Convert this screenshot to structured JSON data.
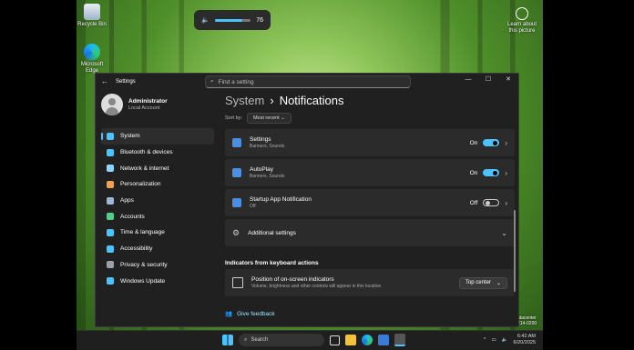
{
  "desktop": {
    "recycle_bin": "Recycle Bin",
    "edge_label": "Microsoft Edge",
    "learn_label": "Learn about this picture",
    "watermark_line1": "atacenter",
    "watermark_line2": "214-0200"
  },
  "volume": {
    "level": 76,
    "label": "76"
  },
  "window": {
    "title": "Settings",
    "search_placeholder": "Find a setting",
    "controls": {
      "minimize": "—",
      "maximize": "☐",
      "close": "✕"
    }
  },
  "profile": {
    "name": "Administrator",
    "subtitle": "Local Account"
  },
  "sidebar": {
    "items": [
      {
        "label": "System",
        "icon": "monitor-icon",
        "color": "#4cc2ff",
        "active": true
      },
      {
        "label": "Bluetooth & devices",
        "icon": "bluetooth-icon",
        "color": "#4cc2ff"
      },
      {
        "label": "Network & internet",
        "icon": "wifi-icon",
        "color": "#8fd3ff"
      },
      {
        "label": "Personalization",
        "icon": "brush-icon",
        "color": "#f0a050"
      },
      {
        "label": "Apps",
        "icon": "apps-icon",
        "color": "#9fb7d6"
      },
      {
        "label": "Accounts",
        "icon": "person-icon",
        "color": "#4fd08a"
      },
      {
        "label": "Time & language",
        "icon": "globe-icon",
        "color": "#4cc2ff"
      },
      {
        "label": "Accessibility",
        "icon": "accessibility-icon",
        "color": "#4cc2ff"
      },
      {
        "label": "Privacy & security",
        "icon": "shield-icon",
        "color": "#9aa0a6"
      },
      {
        "label": "Windows Update",
        "icon": "update-icon",
        "color": "#4cc2ff"
      }
    ]
  },
  "main": {
    "breadcrumb_parent": "System",
    "breadcrumb_sep": "›",
    "page_title": "Notifications",
    "sort_label": "Sort by:",
    "sort_value": "Most recent",
    "apps": [
      {
        "title": "Settings",
        "subtitle": "Banners, Sounds",
        "state": "On",
        "on": true,
        "icon_color": "#4a90e2"
      },
      {
        "title": "AutoPlay",
        "subtitle": "Banners, Sounds",
        "state": "On",
        "on": true,
        "icon_color": "#4a90e2"
      },
      {
        "title": "Startup App Notification",
        "subtitle": "Off",
        "state": "Off",
        "on": false,
        "icon_color": "#4a90e2"
      }
    ],
    "additional_settings": "Additional settings",
    "section_title": "Indicators from keyboard actions",
    "indicator": {
      "title": "Position of on-screen indicators",
      "subtitle": "Volume, brightness and other controls will appear in this location",
      "value": "Top center"
    },
    "feedback": "Give feedback"
  },
  "taskbar": {
    "search_label": "Search",
    "time": "6:42 AM",
    "date": "6/20/2025"
  }
}
